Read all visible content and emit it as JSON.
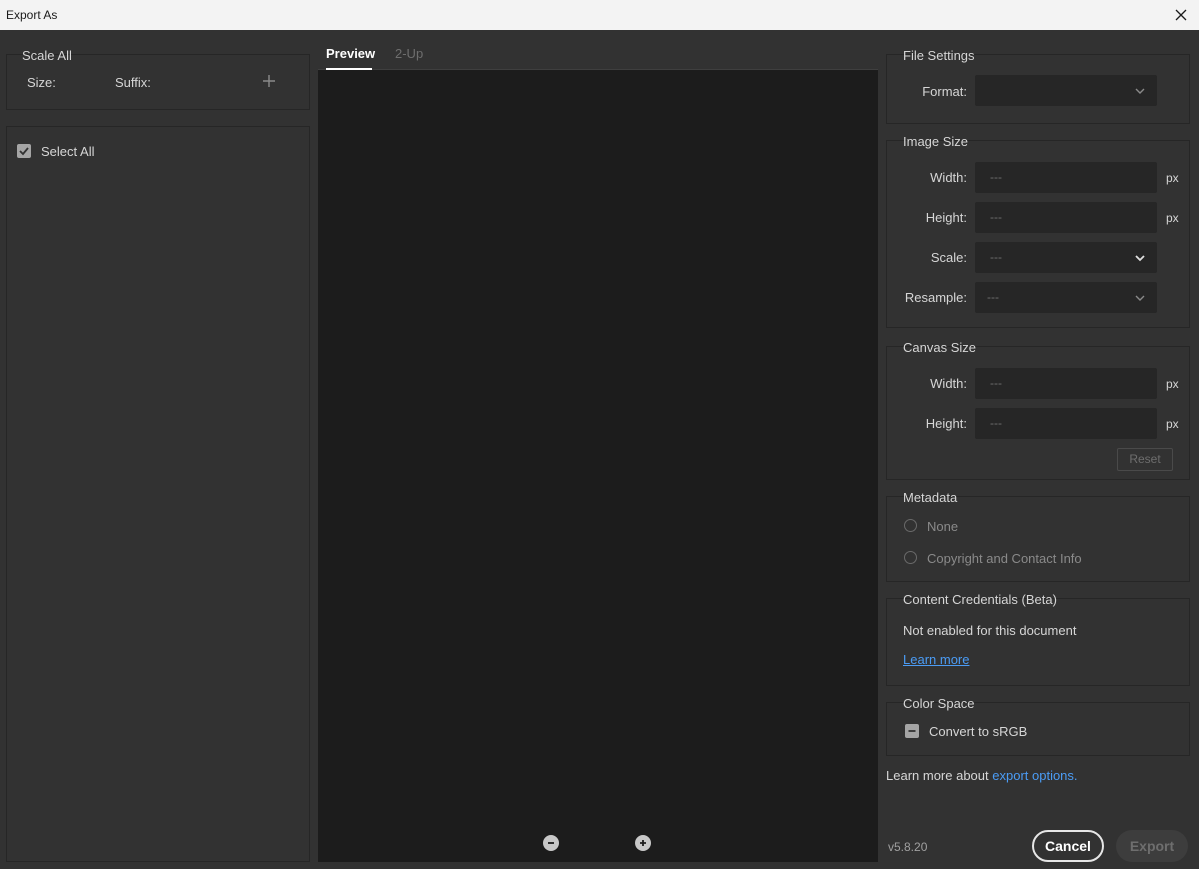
{
  "window": {
    "title": "Export As"
  },
  "scale_all": {
    "title": "Scale All",
    "size_label": "Size:",
    "suffix_label": "Suffix:"
  },
  "assets": {
    "select_all_label": "Select All"
  },
  "preview": {
    "tabs": [
      {
        "label": "Preview",
        "active": true
      },
      {
        "label": "2-Up",
        "active": false
      }
    ]
  },
  "file_settings": {
    "title": "File Settings",
    "format_label": "Format:",
    "format_value": ""
  },
  "image_size": {
    "title": "Image Size",
    "width_label": "Width:",
    "width_value": "---",
    "height_label": "Height:",
    "height_value": "---",
    "scale_label": "Scale:",
    "scale_value": "---",
    "resample_label": "Resample:",
    "resample_value": "---",
    "unit": "px"
  },
  "canvas_size": {
    "title": "Canvas Size",
    "width_label": "Width:",
    "width_value": "---",
    "height_label": "Height:",
    "height_value": "---",
    "unit": "px",
    "reset_label": "Reset"
  },
  "metadata": {
    "title": "Metadata",
    "option_none": "None",
    "option_copyright": "Copyright and Contact Info"
  },
  "content_credentials": {
    "title": "Content Credentials (Beta)",
    "status": "Not enabled for this document",
    "learn_more": "Learn more"
  },
  "color_space": {
    "title": "Color Space",
    "convert_label": "Convert to sRGB"
  },
  "footer": {
    "learn_more_prefix": "Learn more about",
    "export_options_link": "export options.",
    "version": "v5.8.20",
    "cancel_label": "Cancel",
    "export_label": "Export"
  },
  "colors": {
    "link": "#4b9cf5",
    "accent_text": "#ffffff",
    "panel_bg": "#323232",
    "preview_bg": "#1c1c1c"
  }
}
